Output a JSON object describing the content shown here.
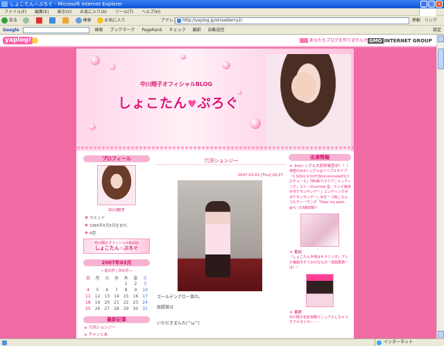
{
  "window": {
    "title": "しょこたん☆ぶろぐ - Microsoft Internet Explorer"
  },
  "menu": [
    "ファイル(F)",
    "編集(E)",
    "表示(V)",
    "お気に入り(A)",
    "ツール(T)",
    "ヘルプ(H)"
  ],
  "toolbar": {
    "back": "戻る",
    "search": "検索",
    "favorites": "お気に入り",
    "address_label": "アドレス(D)",
    "address": "http://yaplog.jp/strawberry2/",
    "go": "移動",
    "links": "リンク"
  },
  "googlebar": {
    "logo": "Google",
    "search_label": "検索",
    "bookmarks": "ブックマーク",
    "pagerank": "PageRank",
    "check": "チェック",
    "translate": "翻訳",
    "autofill": "自動送信",
    "settings": "設定"
  },
  "yaplog": {
    "logo": "yaplog!",
    "promo": "あなたもブログを作りませんか",
    "gmo": "GMO INTERNET GROUP"
  },
  "blog": {
    "subtitle": "中川翔子オフィシャルBLOG",
    "title_a": "しょこたん",
    "title_heart": "♥",
    "title_b": "ぷろぐ"
  },
  "left": {
    "profile_head": "プロフィール",
    "profile_name": "中川翔子",
    "links": [
      "ウミンド",
      "1985年5月5日生まれ",
      "A型"
    ],
    "banner_small": "中川翔子オフィシャルBLOG",
    "banner_big": "しょこたん☆ぶろぐ",
    "cal_head": "2007年03月",
    "cal_nav": "« 前の月 | 次の月 »",
    "weekdays": [
      "日",
      "月",
      "火",
      "水",
      "木",
      "金",
      "土"
    ],
    "weeks": [
      [
        "",
        "",
        "",
        "",
        "1",
        "2",
        "3"
      ],
      [
        "4",
        "5",
        "6",
        "7",
        "8",
        "9",
        "10"
      ],
      [
        "11",
        "12",
        "13",
        "14",
        "15",
        "16",
        "17"
      ],
      [
        "18",
        "19",
        "20",
        "21",
        "22",
        "23",
        "24"
      ],
      [
        "25",
        "26",
        "27",
        "28",
        "29",
        "30",
        "31"
      ]
    ],
    "recent_head": "最新記事",
    "recent": [
      "穴河ションジー",
      "チャンとあ"
    ]
  },
  "entry": {
    "title": "穴河ションジー",
    "date": "2007.03.01 [Thu] 20:27",
    "line1": "ゴールデンアロー賞の。",
    "line2": "局録賞は",
    "line3": "いただきまんた(^ω^)"
  },
  "right": {
    "head": "出演情報",
    "item1_title": "3rdシングル大好評発売中！！！",
    "item1_text": "待望の3rdシングルはトリプルタイプ『1 SOUL'd OUT/Shinnnnnuke[H]フロチュース」TBS新ウマクアニメンディング』スト・01mrilod 星、テレビ東京がポケモンサンデー」エンディングボポケモンサンデー」Mオーコ喰ころんコルティーワング「Dear my pant-girl」の3曲収録!!",
    "item2_title": "番組",
    "item2_text": "「しょこたん今夜はキラリン子」アレビ番組今そうかげなもの一週間再発ーは！！",
    "item3_title": "書籍",
    "item3_text": "中川翔子初全攻略マニュアルしちゃうすアキカイカ・・・"
  },
  "status": {
    "left": "",
    "zone": "インターネット"
  }
}
